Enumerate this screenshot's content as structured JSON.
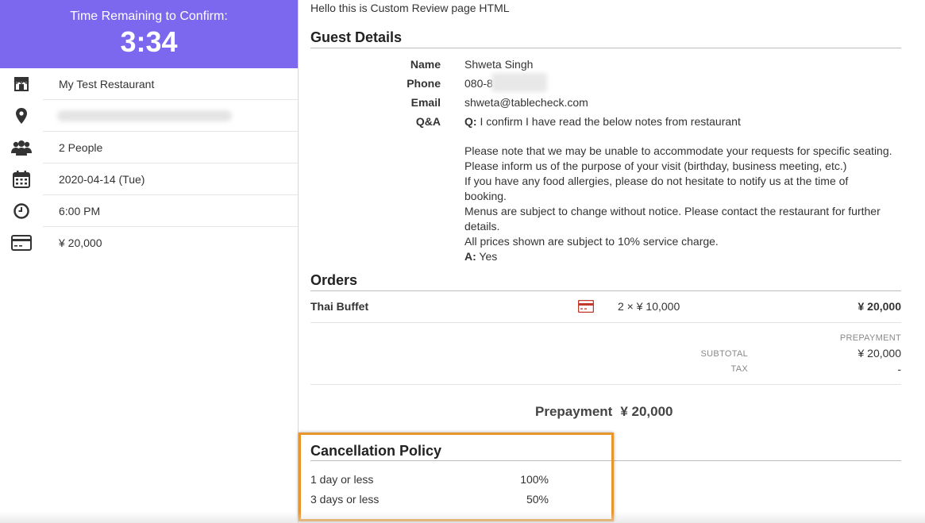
{
  "sidebar": {
    "timer_label": "Time Remaining to Confirm:",
    "timer_value": "3:34",
    "restaurant": "My Test Restaurant",
    "address": "",
    "people": "2 People",
    "date": "2020-04-14 (Tue)",
    "time": "6:00 PM",
    "price": "¥ 20,000",
    "icons": [
      "store-icon",
      "location-pin-icon",
      "people-icon",
      "calendar-icon",
      "clock-icon",
      "credit-card-icon"
    ]
  },
  "main": {
    "hello": "Hello this is Custom Review page HTML",
    "guest": {
      "title": "Guest Details",
      "name_label": "Name",
      "name": "Shweta Singh",
      "phone_label": "Phone",
      "phone": "080-8",
      "email_label": "Email",
      "email": "shweta@tablecheck.com",
      "qa_label": "Q&A",
      "q_prefix": "Q:",
      "question": "I confirm I have read the below notes from restaurant",
      "notes": [
        "Please note that we may be unable to accommodate your requests for specific seating.",
        "Please inform us of the purpose of your visit (birthday, business meeting, etc.)",
        "If you have any food allergies, please do not hesitate to notify us at the time of booking.",
        "Menus are subject to change without notice. Please contact the restaurant for further details.",
        "All prices shown are subject to 10% service charge."
      ],
      "a_prefix": "A:",
      "answer": "Yes"
    },
    "orders": {
      "title": "Orders",
      "item_name": "Thai Buffet",
      "item_qty": "2 × ¥ 10,000",
      "item_price": "¥ 20,000",
      "prepayment_label": "PREPAYMENT",
      "subtotal_label": "SUBTOTAL",
      "subtotal_value": "¥ 20,000",
      "tax_label": "TAX",
      "tax_value": "-",
      "total_label": "Prepayment",
      "total_value": "¥ 20,000"
    },
    "policy": {
      "title": "Cancellation Policy",
      "rows": [
        {
          "label": "1 day or less",
          "pct": "100%"
        },
        {
          "label": "3 days or less",
          "pct": "50%"
        }
      ]
    }
  },
  "colors": {
    "accent": "#7b68ee",
    "highlight_border": "#e8952e",
    "card_icon": "#c0392b"
  }
}
